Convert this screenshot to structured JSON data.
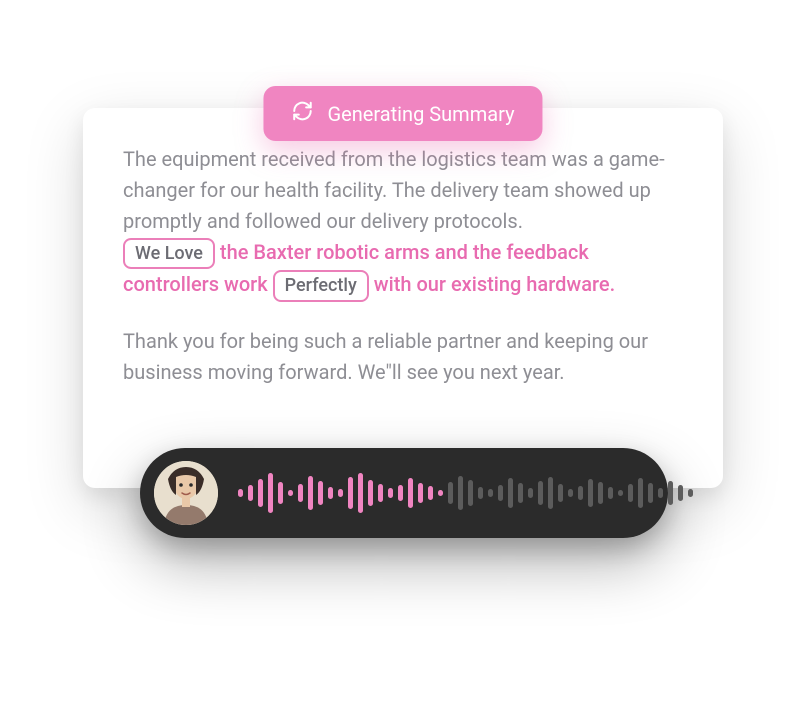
{
  "badge": {
    "label": "Generating  Summary"
  },
  "summary": {
    "p1_part1": "The equipment received from the logistics team was a game-changer for our health facility. The delivery team showed up promptly and followed our delivery protocols.",
    "pill1": "We Love",
    "highlight_part1": " the Baxter robotic arms and the feedback controllers work",
    "pill2": "Perfectly",
    "highlight_part2": " with our existing hardware.",
    "p2": "Thank you for being such a reliable partner and keeping our business moving forward. We\"ll see you next year."
  },
  "player": {
    "avatar_name": "speaker",
    "waveform_heights": [
      8,
      16,
      28,
      40,
      22,
      6,
      18,
      34,
      24,
      12,
      8,
      32,
      40,
      26,
      18,
      10,
      16,
      30,
      20,
      14,
      6,
      22,
      34,
      26,
      12,
      8,
      16,
      30,
      20,
      10,
      24,
      32,
      18,
      8,
      14,
      28,
      22,
      12,
      6,
      18,
      30,
      20,
      10,
      24,
      16,
      8
    ],
    "played_count": 21
  },
  "colors": {
    "accent": "#f085c1",
    "highlight_text": "#e86bb0",
    "muted_text": "#8e8e94",
    "player_bg": "#2b2b2b",
    "bar_unplayed": "#5c5c5c"
  }
}
